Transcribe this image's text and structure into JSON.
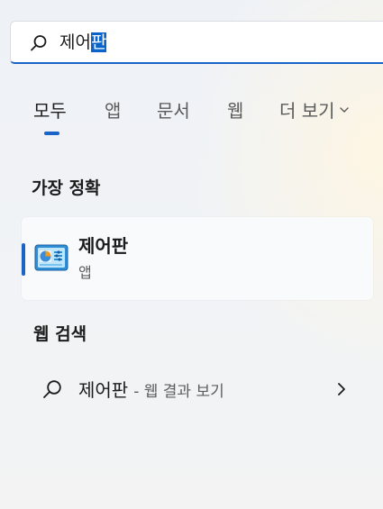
{
  "search": {
    "query_prefix": "제어",
    "query_selected": "판",
    "icon": "search-icon"
  },
  "tabs": [
    {
      "label": "모두",
      "active": true
    },
    {
      "label": "앱"
    },
    {
      "label": "문서"
    },
    {
      "label": "웹"
    },
    {
      "label": "더 보기",
      "icon": "chevron-down-icon"
    }
  ],
  "best_match": {
    "heading": "가장 정확",
    "item": {
      "name": "제어판",
      "type": "앱",
      "icon": "control-panel-icon"
    }
  },
  "web_search": {
    "heading": "웹 검색",
    "item": {
      "query": "제어판",
      "suffix": "- 웹 결과 보기",
      "icon": "search-icon",
      "trailing_icon": "chevron-right-icon"
    }
  },
  "colors": {
    "accent": "#1a64c7",
    "text": "#1b1b1b",
    "muted": "#5e5e5e"
  }
}
